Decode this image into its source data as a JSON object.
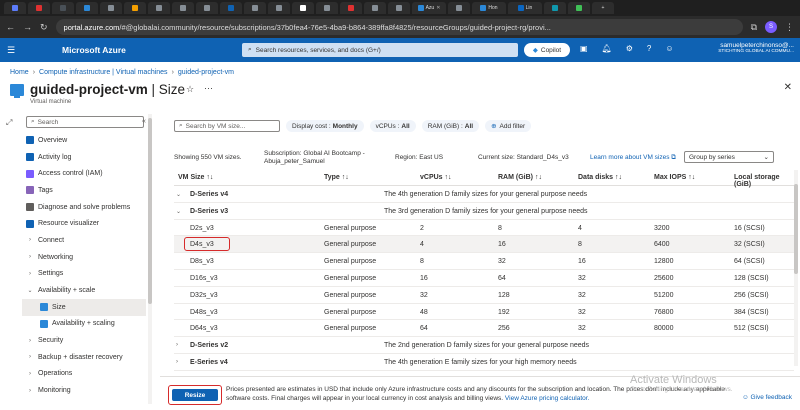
{
  "browser": {
    "address_host": "portal.azure.com",
    "address_path": "/#@globalai.community/resource/subscriptions/37b0fea4-76e5-4ba9-b864-389ffa8f4825/resourceGroups/guided-project-rg/provi...",
    "tabs": [
      "Azu",
      "Hon",
      "Lin"
    ]
  },
  "azure_header": {
    "brand": "Microsoft Azure",
    "search_placeholder": "Search resources, services, and docs (G+/)",
    "copilot_label": "Copilot",
    "user_name": "samuelpeterchinonso@...",
    "user_org": "STICHTING GLOBAL AI COMMU..."
  },
  "breadcrumb": [
    "Home",
    "Compute infrastructure | Virtual machines",
    "guided-project-vm"
  ],
  "page": {
    "title_name": "guided-project-vm",
    "title_section": "| Size",
    "subtitle": "Virtual machine"
  },
  "nav": {
    "search_placeholder": "Search",
    "items": [
      {
        "label": "Overview",
        "color": "#0f62b3"
      },
      {
        "label": "Activity log",
        "color": "#0f62b3"
      },
      {
        "label": "Access control (IAM)",
        "color": "#7a5cff"
      },
      {
        "label": "Tags",
        "color": "#8764b8"
      },
      {
        "label": "Diagnose and solve problems",
        "color": "#605e5c"
      },
      {
        "label": "Resource visualizer",
        "color": "#0f62b3"
      },
      {
        "label": "Connect",
        "chev": "›"
      },
      {
        "label": "Networking",
        "chev": "›"
      },
      {
        "label": "Settings",
        "chev": "›"
      },
      {
        "label": "Availability + scale",
        "chev": "⌄"
      },
      {
        "label": "Size",
        "color": "#2b88d8",
        "sub": true,
        "active": true
      },
      {
        "label": "Availability + scaling",
        "color": "#2b88d8",
        "sub": true
      },
      {
        "label": "Security",
        "chev": "›"
      },
      {
        "label": "Backup + disaster recovery",
        "chev": "›"
      },
      {
        "label": "Operations",
        "chev": "›"
      },
      {
        "label": "Monitoring",
        "chev": "›"
      }
    ]
  },
  "filters": {
    "vm_search_placeholder": "Search by VM size...",
    "display_cost_label": "Display cost :",
    "display_cost_value": "Monthly",
    "vcpus_label": "vCPUs :",
    "vcpus_value": "All",
    "ram_label": "RAM (GiB) :",
    "ram_value": "All",
    "add_filter": "Add filter"
  },
  "info": {
    "showing": "Showing 550 VM sizes.",
    "subscription": "Subscription: Global AI Bootcamp - Abuja_peter_Samuel",
    "region": "Region: East US",
    "current_size": "Current size: Standard_D4s_v3",
    "learn_more": "Learn more about VM sizes",
    "group_by": "Group by series"
  },
  "columns": {
    "name": "VM Size ↑↓",
    "type": "Type ↑↓",
    "vcpus": "vCPUs ↑↓",
    "ram": "RAM (GiB) ↑↓",
    "disks": "Data disks ↑↓",
    "iops": "Max IOPS ↑↓",
    "local": "Local storage (GiB)"
  },
  "rows": [
    {
      "group": true,
      "chev": "⌄",
      "name": "D-Series v4",
      "desc": "The 4th generation D family sizes for your general purpose needs"
    },
    {
      "group": true,
      "chev": "⌄",
      "name": "D-Series v3",
      "desc": "The 3rd generation D family sizes for your general purpose needs"
    },
    {
      "name": "D2s_v3",
      "type": "General purpose",
      "vcpus": "2",
      "ram": "8",
      "disks": "4",
      "iops": "3200",
      "local": "16 (SCSI)"
    },
    {
      "name": "D4s_v3",
      "type": "General purpose",
      "vcpus": "4",
      "ram": "16",
      "disks": "8",
      "iops": "6400",
      "local": "32 (SCSI)",
      "selected": true
    },
    {
      "name": "D8s_v3",
      "type": "General purpose",
      "vcpus": "8",
      "ram": "32",
      "disks": "16",
      "iops": "12800",
      "local": "64 (SCSI)"
    },
    {
      "name": "D16s_v3",
      "type": "General purpose",
      "vcpus": "16",
      "ram": "64",
      "disks": "32",
      "iops": "25600",
      "local": "128 (SCSI)"
    },
    {
      "name": "D32s_v3",
      "type": "General purpose",
      "vcpus": "32",
      "ram": "128",
      "disks": "32",
      "iops": "51200",
      "local": "256 (SCSI)"
    },
    {
      "name": "D48s_v3",
      "type": "General purpose",
      "vcpus": "48",
      "ram": "192",
      "disks": "32",
      "iops": "76800",
      "local": "384 (SCSI)"
    },
    {
      "name": "D64s_v3",
      "type": "General purpose",
      "vcpus": "64",
      "ram": "256",
      "disks": "32",
      "iops": "80000",
      "local": "512 (SCSI)"
    },
    {
      "group": true,
      "chev": "›",
      "name": "D-Series v2",
      "desc": "The 2nd generation D family sizes for your general purpose needs"
    },
    {
      "group": true,
      "chev": "›",
      "name": "E-Series v4",
      "desc": "The 4th generation E family sizes for your high memory needs"
    }
  ],
  "footer": {
    "resize_label": "Resize",
    "disclaimer": "Prices presented are estimates in USD that include only Azure infrastructure costs and any discounts for the subscription and location. The prices don't include any applicable software costs. Final charges will appear in your local currency in cost analysis and billing views.",
    "pricing_link": "View Azure pricing calculator.",
    "feedback": "Give feedback"
  },
  "watermark": {
    "line1": "Activate Windows",
    "line2": "Go to Settings to activate Windows."
  }
}
